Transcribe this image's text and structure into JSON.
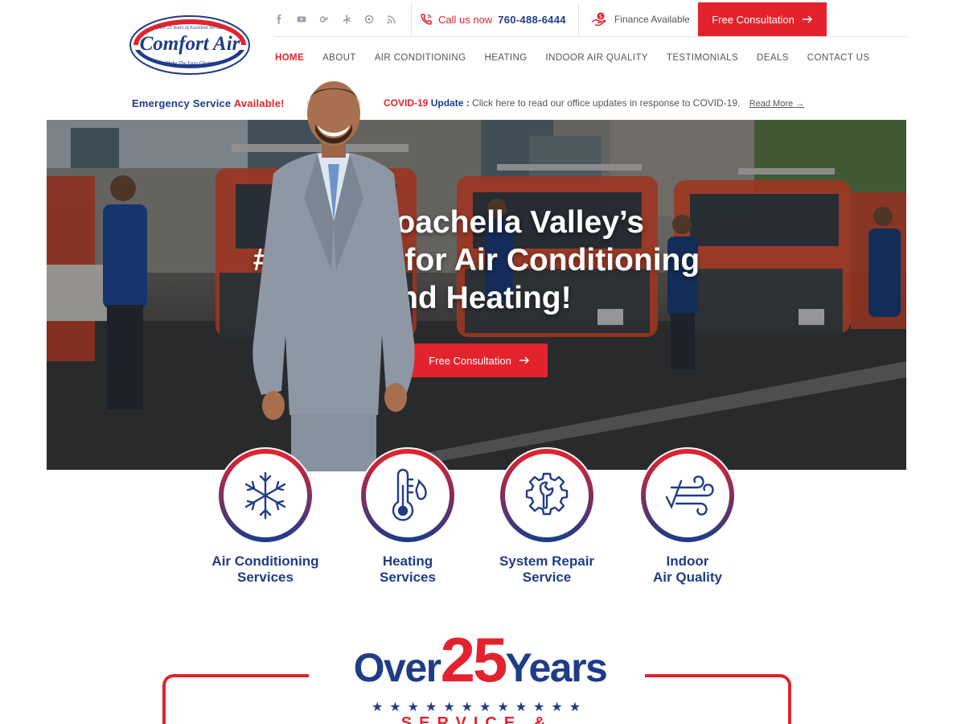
{
  "brand": {
    "logo_top_text": "Over 25 Years of Excellent Service",
    "logo_name": "Comfort Air",
    "logo_tagline": "Make The Easy Choice",
    "colors": {
      "red": "#e2232e",
      "blue": "#1f3c88"
    }
  },
  "topbar": {
    "social_icons": [
      "facebook-icon",
      "youtube-icon",
      "google-plus-icon",
      "yelp-icon",
      "blog-icon",
      "rss-icon"
    ],
    "call_label": "Call us now",
    "phone": "760-488-6444",
    "finance_label": "Finance Available",
    "cta_label": "Free Consultation"
  },
  "nav": {
    "items": [
      "HOME",
      "ABOUT",
      "AIR CONDITIONING",
      "HEATING",
      "INDOOR AIR QUALITY",
      "TESTIMONIALS",
      "DEALS",
      "CONTACT US"
    ],
    "active": "HOME"
  },
  "emergency": {
    "text": "Emergency Service",
    "highlight": "Available!"
  },
  "covid": {
    "prefix": "COVID-19",
    "update": "Update :",
    "message": "Click here to read our office updates in response to COVID-19.",
    "link": "Read More"
  },
  "hero": {
    "line1": "The Coachella Valley’s",
    "line2": "#1 choice for Air Conditioning",
    "line3": "and Heating!",
    "cta_label": "Free Consultation"
  },
  "services": [
    {
      "line1": "Air Conditioning",
      "line2": "Services",
      "icon": "snowflake-icon"
    },
    {
      "line1": "Heating",
      "line2": "Services",
      "icon": "thermometer-icon"
    },
    {
      "line1": "System Repair",
      "line2": "Service",
      "icon": "gear-wrench-icon"
    },
    {
      "line1": "Indoor",
      "line2": "Air Quality",
      "icon": "wind-icon"
    }
  ],
  "years": {
    "over": "Over",
    "number": "25",
    "years": "Years",
    "stars": "★★★★★★★★★★★★",
    "sub": "SERVICE & EXPERIENCE"
  }
}
